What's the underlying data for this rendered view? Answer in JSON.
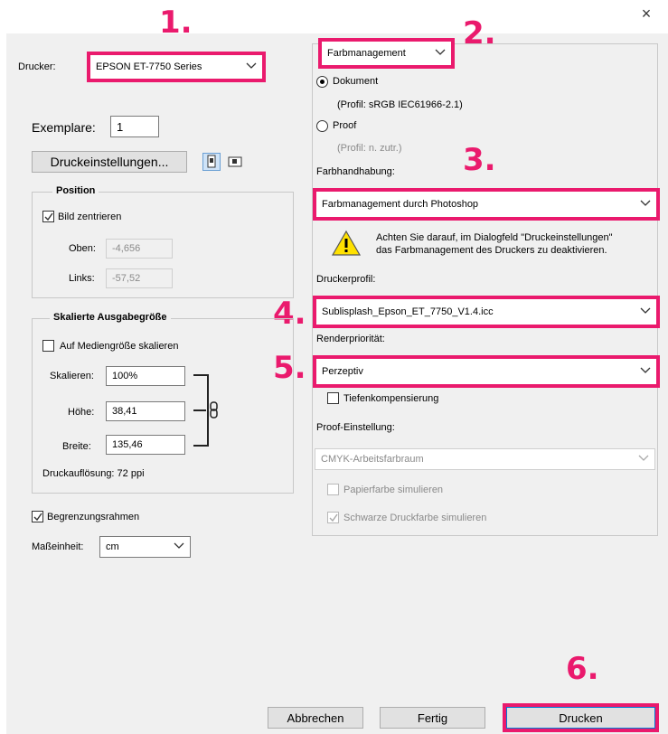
{
  "window": {
    "close_glyph": "×"
  },
  "steps": [
    "1.",
    "2.",
    "3.",
    "4.",
    "5.",
    "6."
  ],
  "printer": {
    "label": "Drucker:",
    "value": "EPSON ET-7750 Series"
  },
  "copies": {
    "label": "Exemplare:",
    "value": "1"
  },
  "print_settings_button": "Druckeinstellungen...",
  "position": {
    "title": "Position",
    "center_label": "Bild zentrieren",
    "top_label": "Oben:",
    "top_value": "-4,656",
    "left_label": "Links:",
    "left_value": "-57,52"
  },
  "scaled": {
    "title": "Skalierte Ausgabegröße",
    "fit_label": "Auf Mediengröße skalieren",
    "scale_label": "Skalieren:",
    "scale_value": "100%",
    "height_label": "Höhe:",
    "height_value": "38,41",
    "width_label": "Breite:",
    "width_value": "135,46",
    "resolution": "Druckauflösung: 72 ppi"
  },
  "bounding_box_label": "Begrenzungsrahmen",
  "units": {
    "label": "Maßeinheit:",
    "value": "cm"
  },
  "right": {
    "mode_select": "Farbmanagement",
    "document_label": "Dokument",
    "document_profile": "(Profil: sRGB IEC61966-2.1)",
    "proof_label": "Proof",
    "proof_profile": "(Profil: n. zutr.)",
    "color_handling_label": "Farbhandhabung:",
    "color_handling_value": "Farbmanagement durch Photoshop",
    "warning_text_1": "Achten Sie darauf, im Dialogfeld \"Druckeinstellungen\"",
    "warning_text_2": "das Farbmanagement des Druckers zu deaktivieren.",
    "printer_profile_label": "Druckerprofil:",
    "printer_profile_value": "Sublisplash_Epson_ET_7750_V1.4.icc",
    "render_label": "Renderpriorität:",
    "render_value": "Perzeptiv",
    "depth_comp_label": "Tiefenkompensierung",
    "proof_setting_label": "Proof-Einstellung:",
    "proof_setting_value": "CMYK-Arbeitsfarbraum",
    "paper_color_label": "Papierfarbe simulieren",
    "black_ink_label": "Schwarze Druckfarbe simulieren"
  },
  "buttons": {
    "cancel": "Abbrechen",
    "done": "Fertig",
    "print": "Drucken"
  },
  "colors": {
    "highlight": "#ea1a6d",
    "panel": "#f0f0f0"
  }
}
